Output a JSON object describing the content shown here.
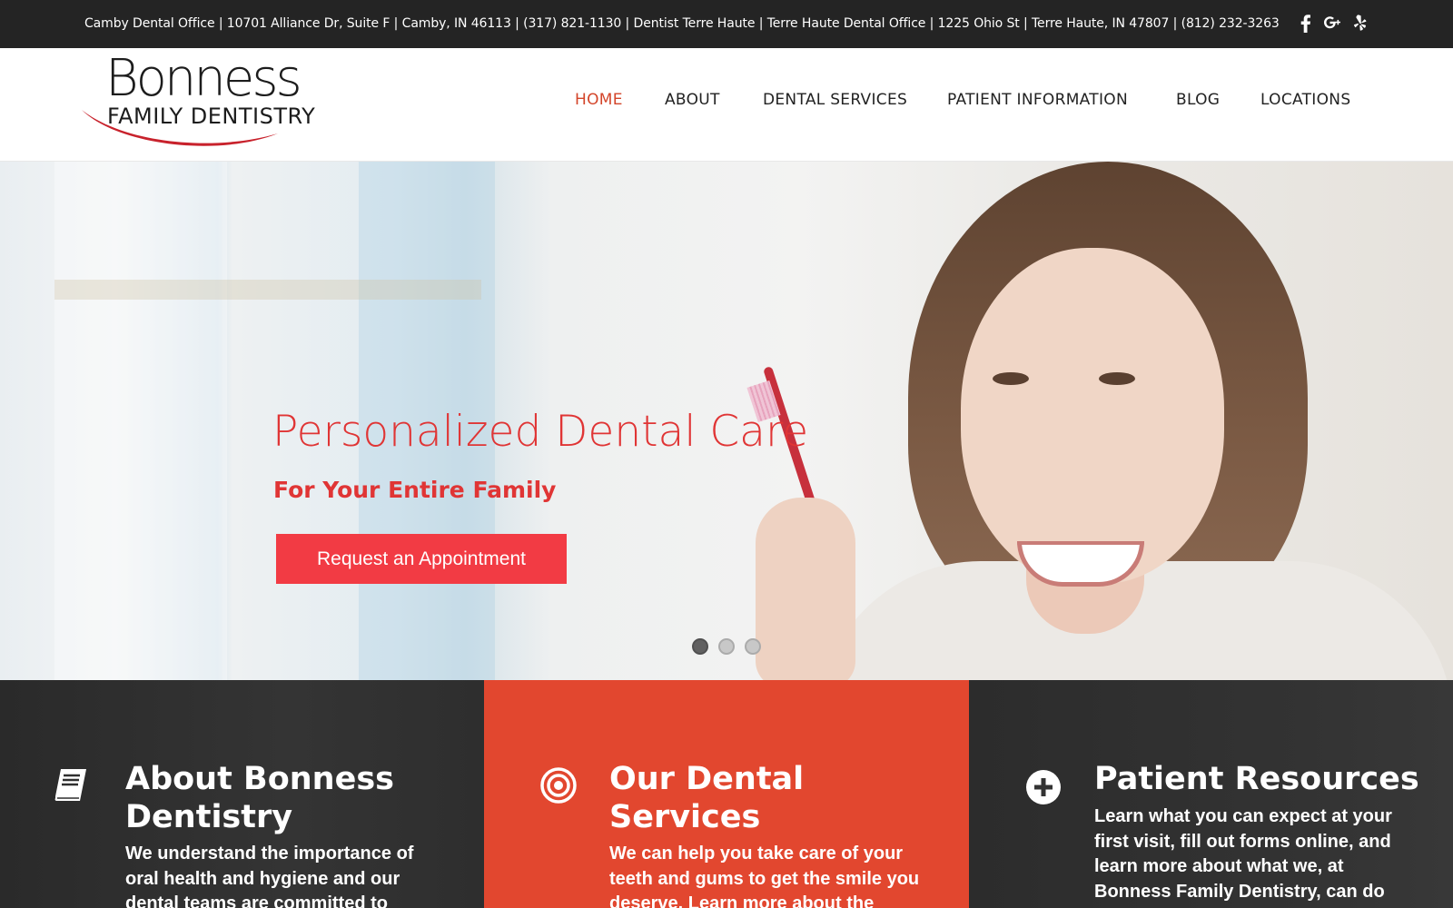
{
  "topbar": {
    "info": "Camby Dental Office | 10701 Alliance Dr, Suite F | Camby, IN 46113 | (317) 821-1130 | Dentist Terre Haute | Terre Haute Dental Office | 1225 Ohio St | Terre Haute, IN 47807 | (812) 232-3263",
    "social_icons": [
      "facebook-icon",
      "google-plus-icon",
      "yelp-icon"
    ]
  },
  "logo": {
    "line1": "Bonness",
    "line2": "FAMILY  DENTISTRY",
    "accent_color": "#c8222c"
  },
  "nav": {
    "items": [
      "HOME",
      "ABOUT",
      "DENTAL SERVICES",
      "PATIENT INFORMATION",
      "BLOG",
      "LOCATIONS"
    ],
    "active": "HOME",
    "active_color": "#d3452a"
  },
  "hero": {
    "headline": "Personalized Dental Care",
    "subline": "For Your Entire Family",
    "cta_label": "Request an Appointment",
    "cta_color": "#f23b44",
    "slides_total": 3,
    "active_slide": 1
  },
  "panels": [
    {
      "icon": "book-icon",
      "title": "About Bonness Dentistry",
      "text": "We understand the importance of oral health and hygiene and our dental teams are committed to"
    },
    {
      "icon": "target-icon",
      "title": "Our Dental Services",
      "text": "We can help you take care of your teeth and gums to get the smile you deserve. Learn more about the"
    },
    {
      "icon": "plus-circle-icon",
      "title": "Patient Resources",
      "text": "Learn what you can expect at your first visit, fill out forms online, and learn more about what we, at Bonness Family Dentistry, can do to"
    }
  ]
}
